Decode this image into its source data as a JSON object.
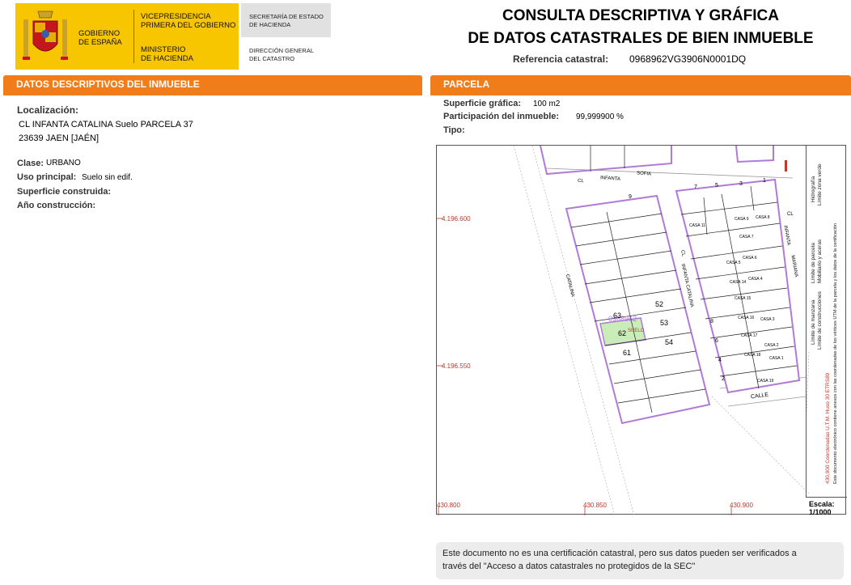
{
  "header": {
    "gobierno": [
      "GOBIERNO",
      "DE ESPAÑA"
    ],
    "vicepresidencia": [
      "VICEPRESIDENCIA",
      "PRIMERA DEL GOBIERNO"
    ],
    "ministerio": [
      "MINISTERIO",
      "DE HACIENDA"
    ],
    "secretaria": [
      "SECRETARÍA DE ESTADO",
      "DE HACIENDA"
    ],
    "direccion": [
      "DIRECCIÓN GENERAL",
      "DEL CATASTRO"
    ],
    "title_line1": "CONSULTA DESCRIPTIVA Y GRÁFICA",
    "title_line2": "DE DATOS CATASTRALES DE BIEN INMUEBLE",
    "referencia_label": "Referencia catastral:",
    "referencia_value": "0968962VG3906N0001DQ"
  },
  "left": {
    "section_title": "DATOS DESCRIPTIVOS DEL INMUEBLE",
    "localizacion_label": "Localización:",
    "localizacion_line1": "CL INFANTA CATALINA  Suelo PARCELA 37",
    "localizacion_line2": "23639 JAEN [JAÉN]",
    "clase_label": "Clase:",
    "clase_value": "URBANO",
    "uso_label": "Uso principal:",
    "uso_value": "Suelo sin edif.",
    "superficie_label": "Superficie construida:",
    "anio_label": "Año construcción:"
  },
  "right": {
    "section_title": "PARCELA",
    "superficie_label": "Superficie gráfica:",
    "superficie_value": "100 m2",
    "participacion_label": "Participación del inmueble:",
    "participacion_value": "99,999900 %",
    "tipo_label": "Tipo:"
  },
  "map": {
    "y_coords": [
      "4.196.600",
      "4.196.550"
    ],
    "x_coords": [
      "430.800",
      "430.850",
      "430.900"
    ],
    "streets": [
      "CL",
      "INFANTA",
      "SOFIA",
      "CATALINA",
      "CL",
      "INFANTA CATALINA",
      "CL",
      "INFANTA",
      "MARIANA",
      "CALLE"
    ],
    "parcel_numbers": [
      "9",
      "63",
      "62",
      "61",
      "52",
      "53",
      "54",
      "7",
      "5",
      "3",
      "1",
      "2",
      "4",
      "6",
      "8"
    ],
    "houses": [
      "CASA 11",
      "CASA 9",
      "CASA 8",
      "CASA 7",
      "CASA 6",
      "CASA 5",
      "CASA 14",
      "CASA 4",
      "CASA 15",
      "CASA 16",
      "CASA 3",
      "CASA 17",
      "CASA 2",
      "CASA 18",
      "CASA 1",
      "CASA 19"
    ],
    "highlight_code": "0968962",
    "highlight_label": "SUELO",
    "scale_label": "Escala:",
    "scale_value": "1/1000",
    "legend": {
      "limite_manzana": "Límite de manzana",
      "limite_parcela": "Límite de parcela",
      "hidrografia": "Hidrografía",
      "limite_construcciones": "Límite de construcciones",
      "mobiliario": "Mobiliario y aceras",
      "limite_zona_verde": "Límite zona verde",
      "coordenadas": "430,900 Coordenadas U.T.M. Huso 30 ETRS89",
      "documento": "Este documento electrónico contiene anexos con las coordenadas de los vértices UTM de la parcela y los datos de la certificación"
    },
    "colors": {
      "parcel": "#b07ad6",
      "highlight": "#c9ecb8",
      "coord": "#c0392b",
      "accent": "#f07d1a"
    }
  },
  "footer": {
    "note_line1": "Este documento no es una certificación catastral, pero sus datos pueden ser verificados a",
    "note_line2": "través del \"Acceso a datos catastrales no protegidos de la SEC\""
  }
}
